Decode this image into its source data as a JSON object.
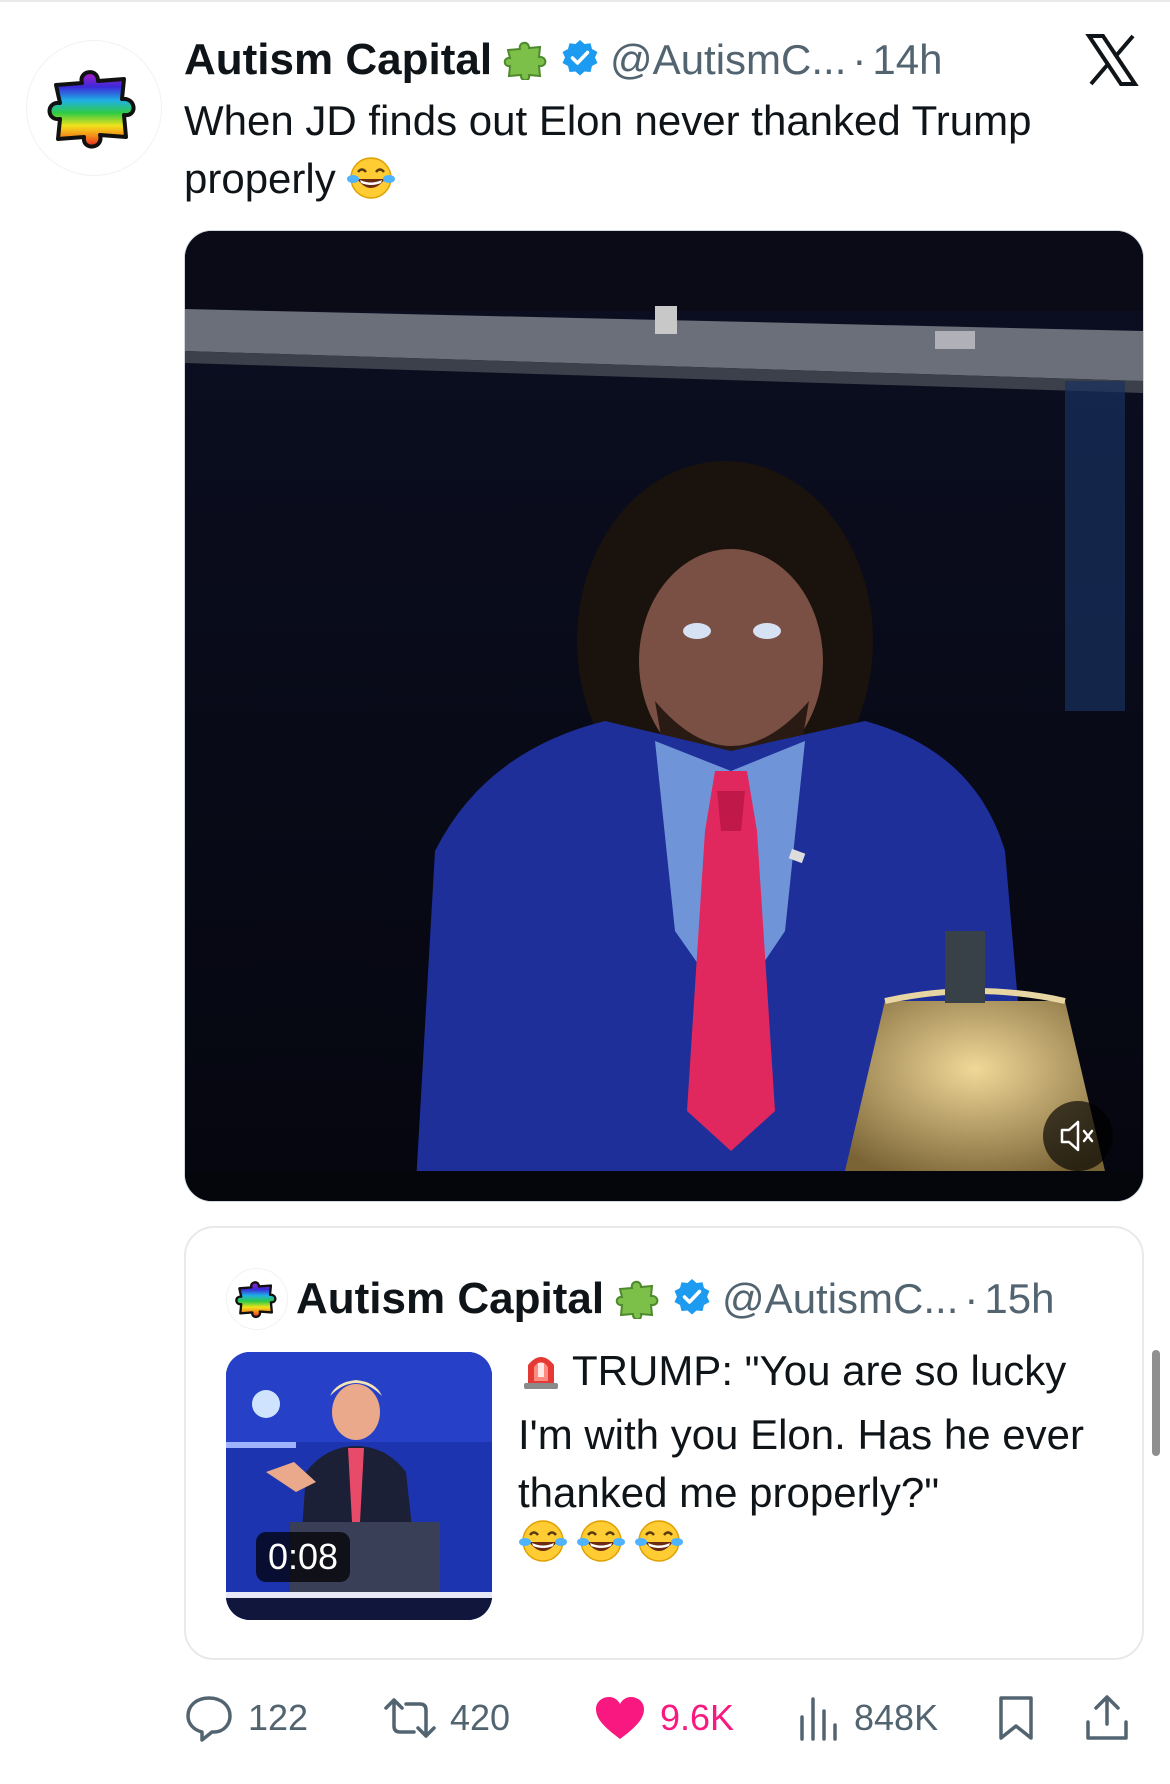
{
  "tweet": {
    "author_name": "Autism Capital",
    "handle": "@AutismC...",
    "separator": "·",
    "time": "14h",
    "text": "When JD finds out Elon never thanked Trump properly"
  },
  "media": {
    "type": "video",
    "muted": true
  },
  "quoted": {
    "author_name": "Autism Capital",
    "handle": "@AutismC...",
    "separator": "·",
    "time": "15h",
    "text": "TRUMP: \"You are so lucky I'm with you Elon. Has he ever thanked me properly?\"",
    "video_duration": "0:08"
  },
  "actions": {
    "replies": "122",
    "reposts": "420",
    "likes": "9.6K",
    "views": "848K"
  },
  "colors": {
    "verified": "#1d9bf0",
    "like": "#f91880",
    "secondary_text": "#536471"
  },
  "icons": [
    "puzzle-icon",
    "verified-badge-icon",
    "x-logo-icon",
    "laughing-emoji-icon",
    "siren-emoji-icon",
    "mute-icon",
    "reply-icon",
    "repost-icon",
    "heart-icon",
    "views-icon",
    "bookmark-icon",
    "share-icon"
  ]
}
